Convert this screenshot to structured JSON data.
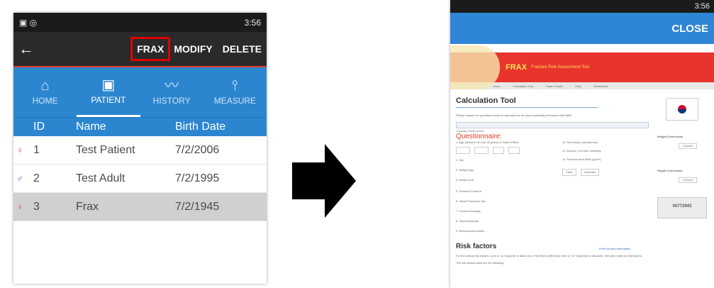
{
  "phone": {
    "status_time": "3:56",
    "appbar": {
      "back_icon": "arrow-left-icon",
      "actions": [
        "FRAX",
        "MODIFY",
        "DELETE"
      ],
      "highlight_color": "#e00000"
    },
    "tabs": [
      {
        "label": "HOME",
        "icon": "home-icon"
      },
      {
        "label": "PATIENT",
        "icon": "patient-icon"
      },
      {
        "label": "HISTORY",
        "icon": "chart-line-icon"
      },
      {
        "label": "MEASURE",
        "icon": "device-icon"
      }
    ],
    "table": {
      "headers": [
        "ID",
        "Name",
        "Birth Date"
      ],
      "rows": [
        {
          "sex": "female",
          "id": "1",
          "name": "Test Patient",
          "birth": "7/2/2006"
        },
        {
          "sex": "male",
          "id": "2",
          "name": "Test Adult",
          "birth": "7/2/1995"
        },
        {
          "sex": "female",
          "id": "3",
          "name": "Frax",
          "birth": "7/2/1945"
        }
      ]
    }
  },
  "browser": {
    "status_time": "3:56",
    "close_label": "CLOSE",
    "frax_title": "FRAX",
    "frax_subtitle": "Fracture Risk Assessment Tool",
    "nav": [
      "Home",
      "Calculation Tool",
      "Paper Charts",
      "FAQ",
      "References"
    ],
    "calc_title": "Calculation Tool",
    "calc_intro": "Please answer the questions below to calculate the ten year probability of fracture with BMD.",
    "country_label": "Country: South Korea",
    "questionnaire_title": "Questionnaire:",
    "questions": [
      "1. Age (between 40 and 90 years) or Date of Birth",
      "2. Sex",
      "3. Weight (kg)",
      "4. Height (cm)",
      "5. Previous Fracture",
      "6. Parent Fractured Hip",
      "7. Current Smoking",
      "8. Glucocorticoids",
      "9. Rheumatoid arthritis"
    ],
    "questions_right": [
      "10. Secondary osteoporosis",
      "11. Alcohol 3 or more units/day",
      "12. Femoral neck BMD (g/cm²)"
    ],
    "clear_label": "Clear",
    "calculate_label": "Calculate",
    "weight_conv": "Weight Conversion",
    "height_conv": "Height Conversion",
    "convert_label": "Convert",
    "counter": "00772943",
    "print_label": "Print tool and information",
    "rf_title": "Risk factors",
    "rf_text": "For the clinical risk factors a yes or no response is asked for. If the field is left blank, then a \"no\" response is assumed. See also notes on risk factors.",
    "rf_text2": "The risk factors used are the following"
  }
}
